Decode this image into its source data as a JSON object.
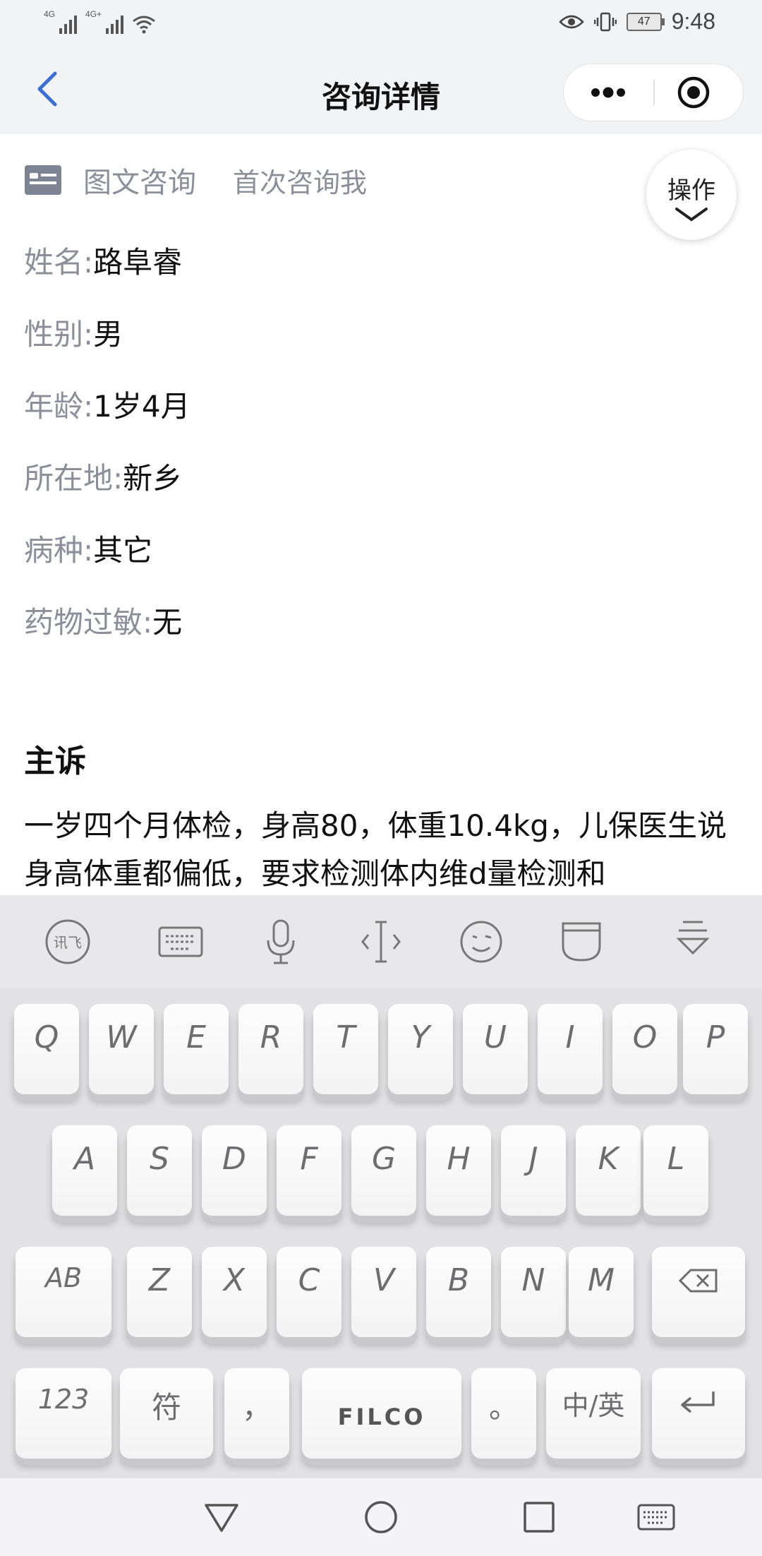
{
  "status_bar": {
    "signal_1": "4G",
    "signal_2": "4G+",
    "battery": "47",
    "time": "9:48"
  },
  "nav": {
    "title": "咨询详情",
    "back_icon": "chevron-left-icon",
    "more_icon": "more-dots-icon",
    "close_icon": "target-circle-icon"
  },
  "header": {
    "tag_type": "图文咨询",
    "tag_first": "首次咨询我",
    "op_button": "操作"
  },
  "patient": {
    "fields": [
      {
        "key": "姓名:",
        "value": "路阜睿"
      },
      {
        "key": "性别:",
        "value": "男"
      },
      {
        "key": "年龄:",
        "value": "1岁4月"
      },
      {
        "key": "所在地:",
        "value": "新乡"
      },
      {
        "key": "病种:",
        "value": "其它"
      },
      {
        "key": "药物过敏:",
        "value": "无"
      }
    ]
  },
  "complaint": {
    "title": "主诉",
    "text": "一岁四个月体检，身高80，体重10.4kg，儿保医生说身高体重都偏低，要求检测体内维d量检测和"
  },
  "toolbar": {
    "icons": [
      "xunfei-logo-icon",
      "keyboard-icon",
      "microphone-icon",
      "cursor-move-icon",
      "emoji-icon",
      "clipboard-icon",
      "collapse-keyboard-icon"
    ]
  },
  "keyboard": {
    "row1": [
      "Q",
      "W",
      "E",
      "R",
      "T",
      "Y",
      "U",
      "I",
      "O",
      "P"
    ],
    "row2": [
      "A",
      "S",
      "D",
      "F",
      "G",
      "H",
      "J",
      "K",
      "L"
    ],
    "row3": [
      "AB",
      "Z",
      "X",
      "C",
      "V",
      "B",
      "N",
      "M"
    ],
    "row4": {
      "num": "123",
      "symbol": "符",
      "comma": "，",
      "space": "FILCO",
      "period": "。",
      "lang": "中/英"
    },
    "backspace_icon": "backspace-icon",
    "enter_icon": "enter-icon"
  },
  "system_nav": {
    "icons": [
      "back-triangle-icon",
      "home-circle-icon",
      "recents-square-icon",
      "keyboard-switch-icon"
    ]
  }
}
